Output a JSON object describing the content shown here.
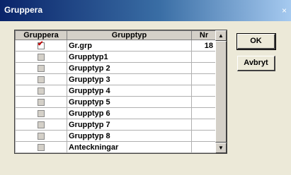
{
  "window": {
    "title": "Gruppera",
    "close_glyph": "×"
  },
  "table": {
    "headers": {
      "gruppera": "Gruppera",
      "grupptyp": "Grupptyp",
      "nr": "Nr"
    },
    "rows": [
      {
        "checked": true,
        "name": "Gr.grp",
        "nr": "18"
      },
      {
        "checked": false,
        "name": "Grupptyp1",
        "nr": ""
      },
      {
        "checked": false,
        "name": "Grupptyp 2",
        "nr": ""
      },
      {
        "checked": false,
        "name": "Grupptyp 3",
        "nr": ""
      },
      {
        "checked": false,
        "name": "Grupptyp 4",
        "nr": ""
      },
      {
        "checked": false,
        "name": "Grupptyp 5",
        "nr": ""
      },
      {
        "checked": false,
        "name": "Grupptyp 6",
        "nr": ""
      },
      {
        "checked": false,
        "name": "Grupptyp 7",
        "nr": ""
      },
      {
        "checked": false,
        "name": "Grupptyp 8",
        "nr": ""
      },
      {
        "checked": false,
        "name": "Anteckningar",
        "nr": ""
      }
    ]
  },
  "buttons": {
    "ok": "OK",
    "cancel": "Avbryt"
  }
}
